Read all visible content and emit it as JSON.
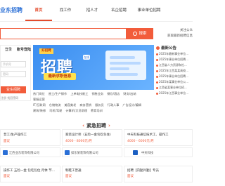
{
  "header": {
    "logo": "业东招聘",
    "nav": [
      "首页",
      "找工作",
      "招人才",
      "名企招聘",
      "事业单位招聘"
    ]
  },
  "search": {
    "placeholder": "",
    "button_label": "搜索"
  },
  "top_right": {
    "line1": "关注公众",
    "line2": "获取最新招聘信息"
  },
  "login": {
    "tab_login": "登录",
    "tab_phone": "账号登陆",
    "field_user": "手机号",
    "field_pass": "密码",
    "button": "业东招聘",
    "link": "注册 找回密码"
  },
  "banner": {
    "tag": "好招聘",
    "title": "招聘",
    "chip": "在线",
    "subtitle": "最新求职信息"
  },
  "notice": {
    "title": "最新公告",
    "items": [
      "2025年最新事业单位...",
      "2025年事业单位招聘...",
      "江西省人力资源和社...",
      "2025年江西某某高校...",
      "2025年事业单位招聘...",
      "2025年某事业单位公...",
      "江西省某事业单位招...",
      "2025年江西事业单位..."
    ]
  },
  "categories": [
    [
      "热门岗位",
      "普工/生产操作",
      "上单电技能工",
      "销售业务",
      "餐饮/酒店",
      "财务/出纳",
      "客服运营"
    ],
    [
      "IT/互联网",
      "仓储物流",
      "美容美发",
      "商务营销",
      "服务员",
      "行政人事",
      "广告设计/编辑"
    ],
    [
      "建筑/装修",
      "司机/驾驶",
      "计算机/文员助理",
      "教育培训"
    ]
  ],
  "section": {
    "title": "紧急招聘"
  },
  "jobs": [
    {
      "title": "普工/生产操作工",
      "salary": "面议",
      "company": ""
    },
    {
      "title": "家装设计师（五险一金包吃包住）",
      "salary": "4000 - 8000元/月",
      "company": ""
    },
    {
      "title": "中天科技通信技术工、操作工",
      "salary": "4000 - 6000元/月",
      "company": ""
    },
    {
      "title": "",
      "salary": "",
      "company": "江西业东装饰有限公司"
    },
    {
      "title": "",
      "salary": "",
      "company": "如东某装饰有限公司"
    },
    {
      "title": "",
      "salary": "",
      "company": "中天科技"
    },
    {
      "title": "操作工 五险一金 包吃包住 月休 节...",
      "salary": "面议",
      "company": ""
    },
    {
      "title": "制鞋工普通",
      "salary": "面议",
      "company": ""
    },
    {
      "title": "招聘【内勤外勤】专员",
      "salary": "面议",
      "company": ""
    }
  ],
  "colors": {
    "accent": "#f25c3b",
    "brand_blue": "#2a6fd6"
  }
}
